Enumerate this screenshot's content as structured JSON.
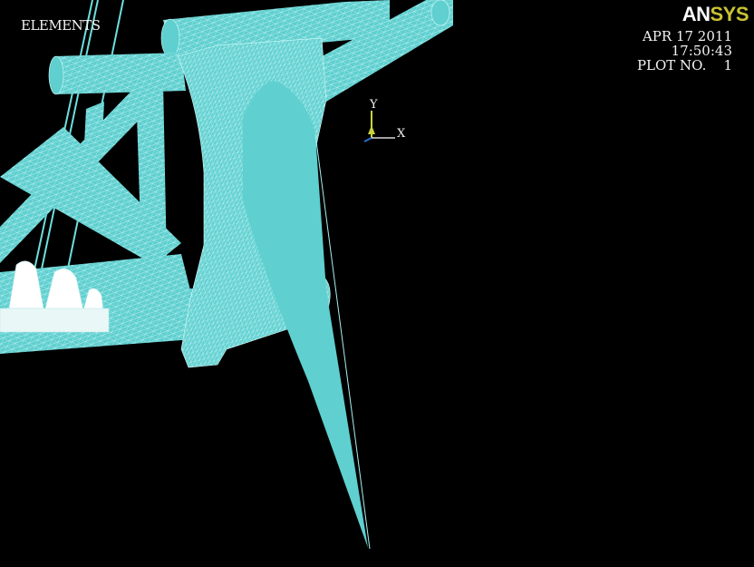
{
  "window": {
    "plot_type": "ELEMENTS",
    "brand_an": "AN",
    "brand_sys": "SYS",
    "date": "APR 17 2011",
    "time": "17:50:43",
    "plot_no_label": "PLOT NO.",
    "plot_no": "1"
  },
  "triad": {
    "y_label": "Y",
    "x_label": "X"
  },
  "colors": {
    "background": "#000000",
    "mesh_fill": "#5fcfcf",
    "mesh_lines": "#d8fbfb",
    "brand_accent": "#c9c233",
    "triad_y": "#c9d23a",
    "triad_x": "#ffffff",
    "triad_z": "#2a6fd0"
  },
  "icons": {
    "triad": "xyz-axis-triad-icon"
  }
}
